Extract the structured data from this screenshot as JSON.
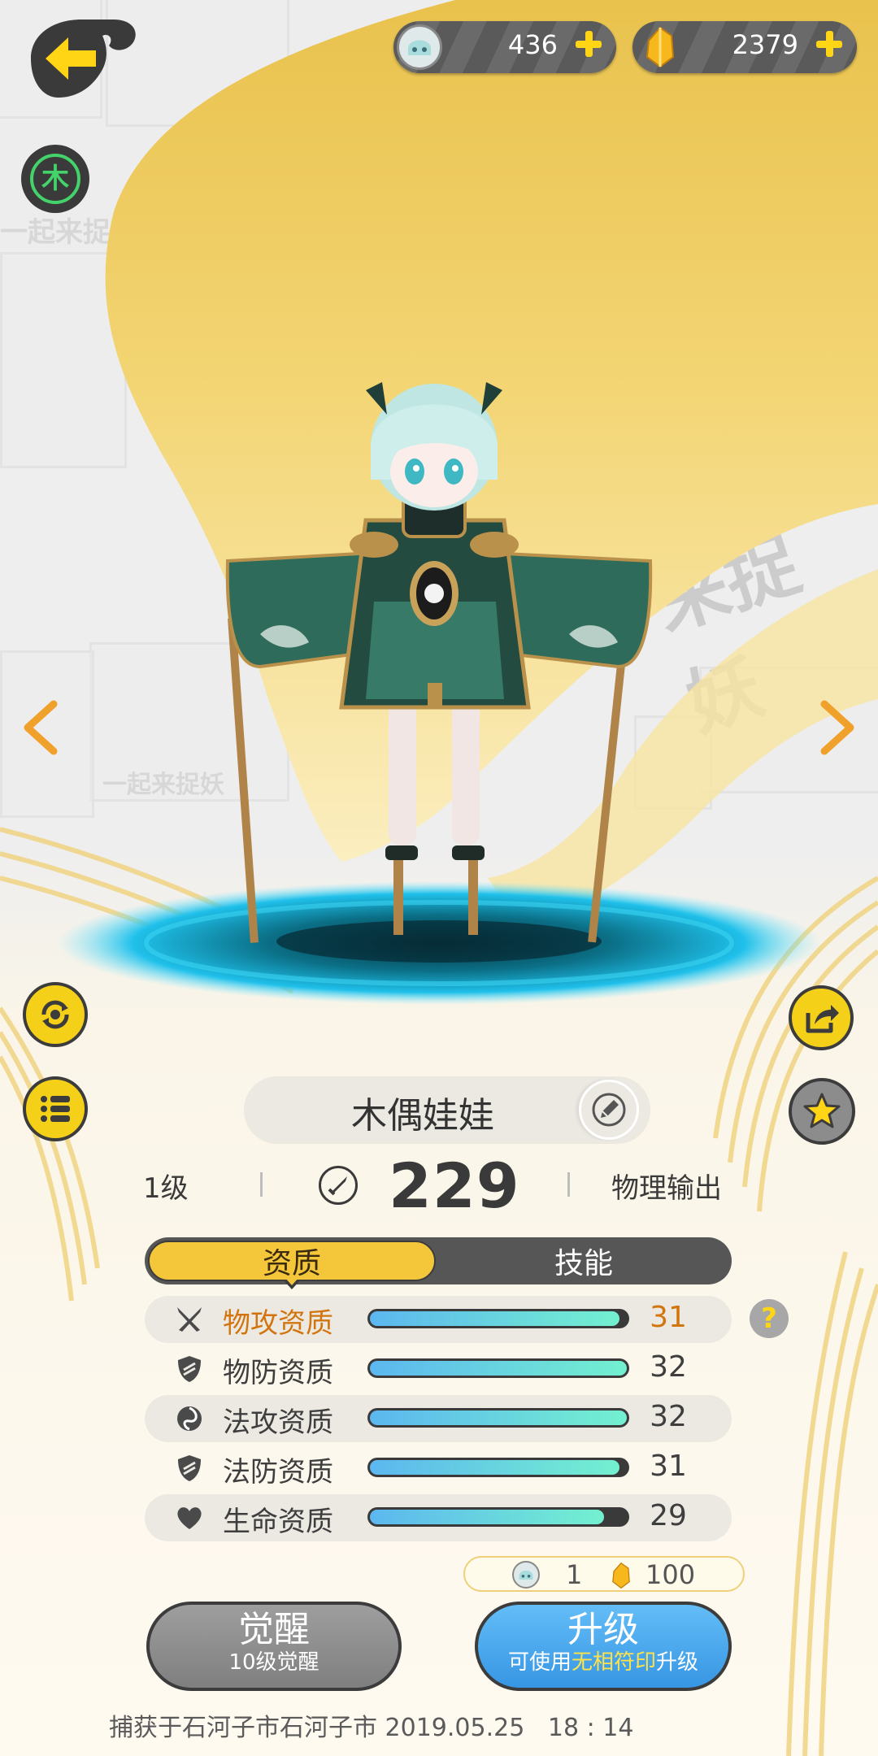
{
  "currency": {
    "souls": "436",
    "crystals": "2379"
  },
  "element_badge": "木",
  "background_text": {
    "left": "一起来捉妖",
    "right": "来捉妖"
  },
  "character": {
    "name": "木偶娃娃",
    "level": "1级",
    "power": "229",
    "role": "物理输出"
  },
  "tabs": [
    {
      "label": "资质",
      "active": true
    },
    {
      "label": "技能",
      "active": false
    }
  ],
  "stats": [
    {
      "label": "物攻资质",
      "value": "31",
      "fill": 0.97,
      "icon": "crossed-swords-icon",
      "highlight": true
    },
    {
      "label": "物防资质",
      "value": "32",
      "fill": 1.0,
      "icon": "shield-icon",
      "highlight": false
    },
    {
      "label": "法攻资质",
      "value": "32",
      "fill": 1.0,
      "icon": "magic-swirl-icon",
      "highlight": false
    },
    {
      "label": "法防资质",
      "value": "31",
      "fill": 0.97,
      "icon": "shield-icon",
      "highlight": false
    },
    {
      "label": "生命资质",
      "value": "29",
      "fill": 0.91,
      "icon": "heart-icon",
      "highlight": false
    }
  ],
  "cost": {
    "souls": "1",
    "crystals": "100"
  },
  "awaken": {
    "label": "觉醒",
    "sub": "10级觉醒"
  },
  "upgrade": {
    "label": "升级",
    "sub_prefix": "可使用",
    "sub_highlight": "无相符印",
    "sub_suffix": "升级"
  },
  "caught_info": "捕获于石河子市石河子市 2019.05.25   18 : 14",
  "colors": {
    "accent_yellow": "#f4c63a",
    "highlight_orange": "#d2750f",
    "upgrade_blue": "#46a6f0",
    "awaken_gray": "#8c8c8c",
    "portal_cyan": "#1fc0ea"
  }
}
